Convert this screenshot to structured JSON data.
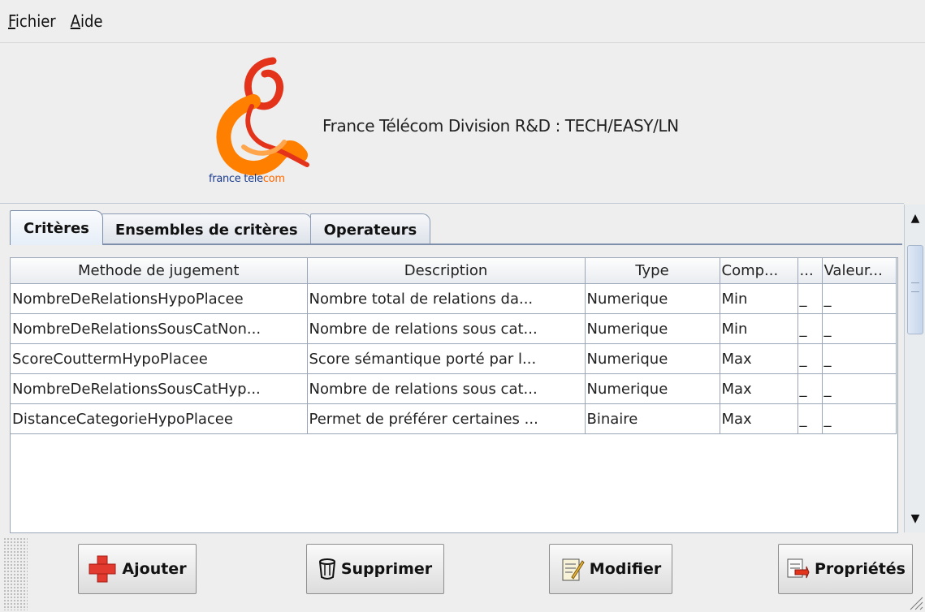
{
  "menu": {
    "items": [
      {
        "mnemonic": "F",
        "rest": "ichier"
      },
      {
        "mnemonic": "A",
        "rest": "ide"
      }
    ]
  },
  "header": {
    "title": "France Télécom Division R&D : TECH/EASY/LN",
    "logo_text_a": "france tele",
    "logo_text_b": "com"
  },
  "tabs": [
    {
      "label": "Critères"
    },
    {
      "label": "Ensembles de critères"
    },
    {
      "label": "Operateurs"
    }
  ],
  "table": {
    "columns": [
      "Methode de jugement",
      "Description",
      "Type",
      "Comp...",
      "...",
      "Valeur..."
    ],
    "rows": [
      [
        "NombreDeRelationsHypoPlacee",
        "Nombre total de relations da...",
        "Numerique",
        "Min",
        "_",
        "_"
      ],
      [
        "NombreDeRelationsSousCatNon...",
        "Nombre de relations sous cat...",
        "Numerique",
        "Min",
        "_",
        "_"
      ],
      [
        "ScoreCouttermHypoPlacee",
        "Score sémantique porté par l...",
        "Numerique",
        "Max",
        "_",
        "_"
      ],
      [
        "NombreDeRelationsSousCatHyp...",
        "Nombre de relations sous cat...",
        "Numerique",
        "Max",
        "_",
        "_"
      ],
      [
        "DistanceCategorieHypoPlacee",
        "Permet de préférer certaines ...",
        "Binaire",
        "Max",
        "_",
        "_"
      ]
    ]
  },
  "toolbar": {
    "add_label": "Ajouter",
    "delete_label": "Supprimer",
    "edit_label": "Modifier",
    "props_label": "Propriétés"
  },
  "colors": {
    "logo_red": "#e4331b",
    "logo_orange": "#ff7f00",
    "logo_blue": "#1b3c8c"
  },
  "icons": [
    "plus-icon",
    "trash-icon",
    "edit-icon",
    "properties-icon",
    "scroll-up-icon",
    "scroll-down-icon"
  ]
}
